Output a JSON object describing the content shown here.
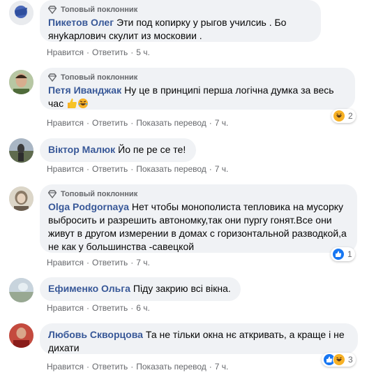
{
  "badge_label": "Топовый поклонник",
  "actions": {
    "like": "Нравится",
    "reply": "Ответить",
    "translate": "Показать перевод"
  },
  "comments": [
    {
      "author": "Пикетов Олег",
      "text": "Эти под копирку у рыгов училсиь . Бо януkарлович скулит из московии .",
      "time": "5 ч."
    },
    {
      "author": "Петя Иванджак",
      "text": "Ну це в принципі перша логічна думка за весь час",
      "time": "7 ч.",
      "reactions_count": "2"
    },
    {
      "author": "Віктор Малюк",
      "text": "Йо пе ре се те!",
      "time": "7 ч."
    },
    {
      "author": "Olga Podgornaya",
      "text": "Нет чтобы монополиста тепловика на мусорку выбросить и разрешить автономку,так они пургу гонят.Все они живут в другом измерении в домах с горизонтальной разводкой,а не как у большинства -савецкой",
      "time": "7 ч.",
      "reactions_count": "1"
    },
    {
      "author": "Ефименко Ольга",
      "text": "Піду закрию всі вікна.",
      "time": "6 ч."
    },
    {
      "author": "Любовь Скворцова",
      "text": "Та не тільки окна нє аткривать, а краще і не дихати",
      "time": "7 ч.",
      "reactions_count": "3"
    }
  ],
  "colors": {
    "author": "#385898",
    "bubble": "#f0f2f5",
    "meta": "#65676b",
    "like_blue": "#1877f2",
    "haha_yellow": "#f7b125"
  }
}
